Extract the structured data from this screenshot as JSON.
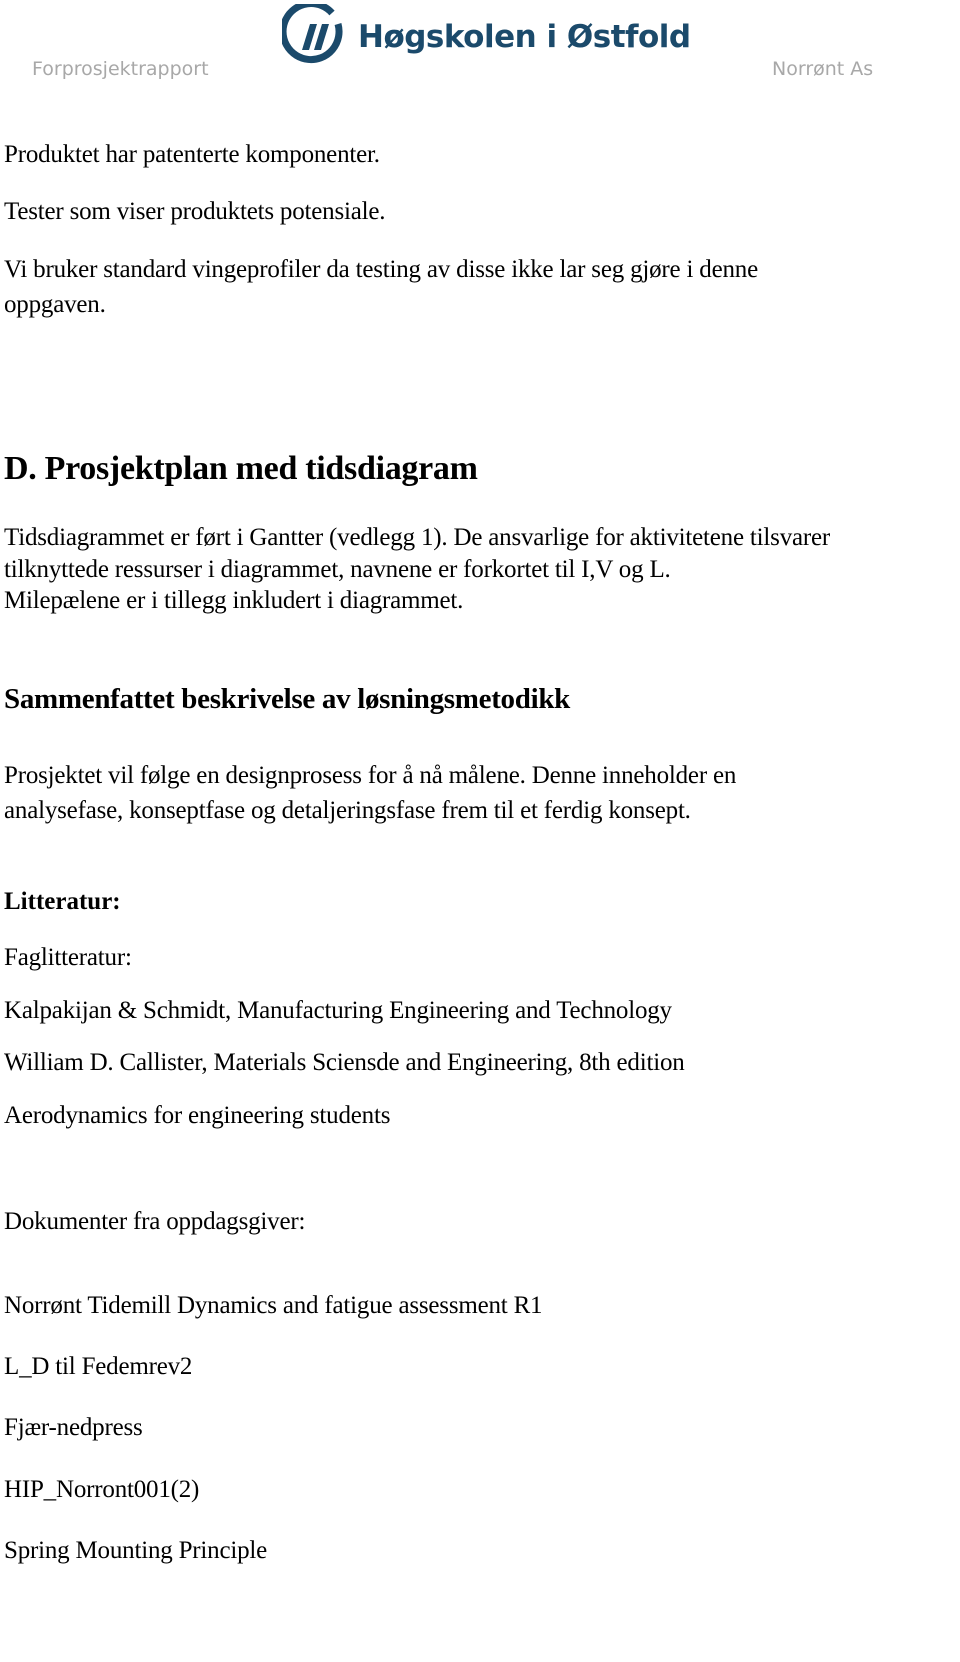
{
  "header": {
    "logo_text": "Høgskolen i Østfold",
    "left_label": "Forprosjektrapport",
    "right_label": "Norrønt As",
    "brand_color": "#1b4a6b",
    "logo_icon": "hiof-logo-icon"
  },
  "intro": {
    "lines": [
      "Produktet har patenterte komponenter.",
      "Tester som viser produktets potensiale.",
      "Vi bruker standard vingeprofiler da testing av disse ikke lar seg gjøre i denne",
      "oppgaven."
    ]
  },
  "section_d": {
    "heading": "D. Prosjektplan med tidsdiagram",
    "lines": [
      "Tidsdiagrammet er ført i Gantter (vedlegg 1). De ansvarlige for aktivitetene tilsvarer",
      "tilknyttede ressurser i diagrammet, navnene er forkortet til I,V og L.",
      "Milepælene er i tillegg inkludert i diagrammet."
    ]
  },
  "method": {
    "heading": "Sammenfattet beskrivelse av løsningsmetodikk",
    "lines": [
      "Prosjektet vil følge en designprosess for å nå målene. Denne inneholder en",
      "analysefase, konseptfase og detaljeringsfase frem til et ferdig konsept."
    ]
  },
  "literature": {
    "heading": "Litteratur:",
    "subheading": "Faglitteratur:",
    "items": [
      "Kalpakijan & Schmidt, Manufacturing Engineering and Technology",
      "William D. Callister, Materials Sciensde and Engineering, 8th edition",
      "Aerodynamics for engineering students"
    ]
  },
  "client_docs": {
    "heading": "Dokumenter fra oppdagsgiver:",
    "items": [
      "Norrønt Tidemill Dynamics and fatigue assessment R1",
      "L_D til Fedemrev2",
      "Fjær-nedpress",
      "HIP_Norront001(2)",
      "Spring Mounting Principle"
    ]
  }
}
